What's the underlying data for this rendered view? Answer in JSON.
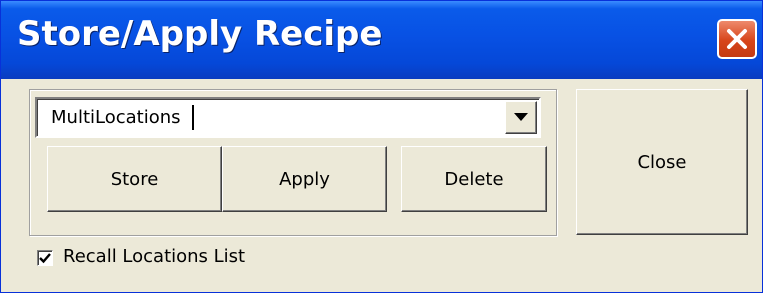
{
  "window": {
    "title": "Store/Apply Recipe",
    "icons": {
      "close": "close-x-icon"
    }
  },
  "recipe": {
    "current_value": "MultiLocations",
    "dropdown_icon": "chevron-down-icon"
  },
  "buttons": {
    "store": "Store",
    "apply": "Apply",
    "delete": "Delete",
    "close": "Close"
  },
  "recall": {
    "label": "Recall Locations List",
    "checked": true
  }
}
